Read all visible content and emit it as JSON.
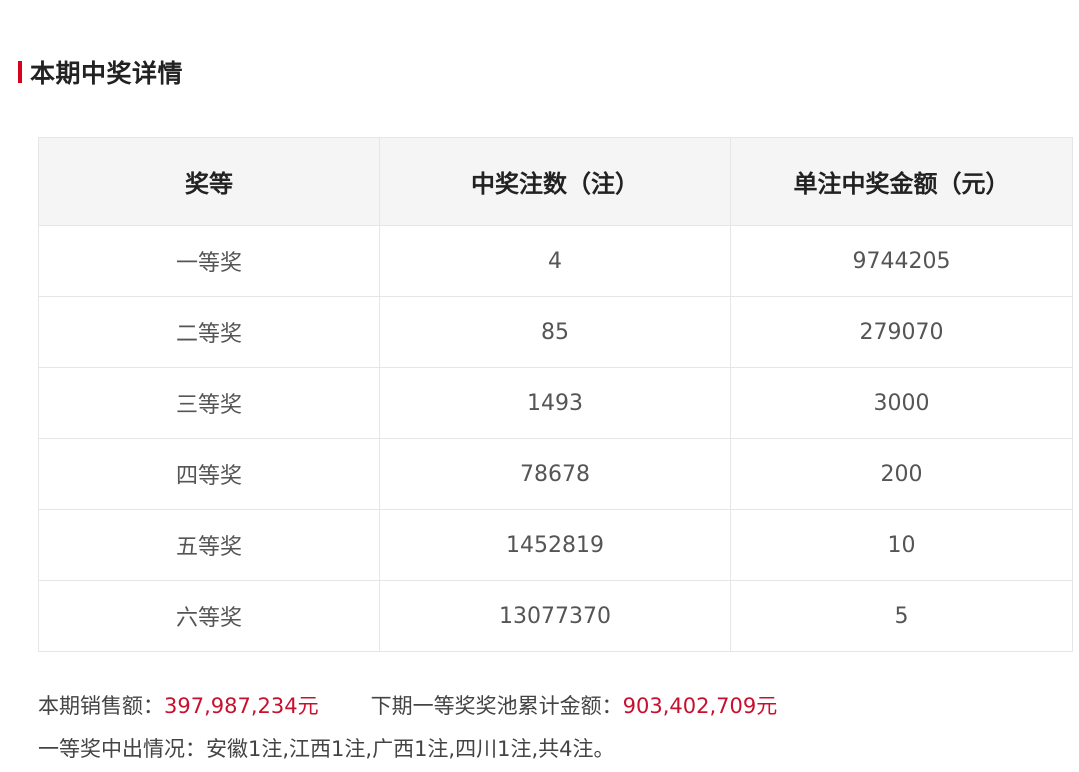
{
  "section": {
    "title": "本期中奖详情",
    "accent_color": "#d9001b"
  },
  "table": {
    "headers": [
      "奖等",
      "中奖注数（注）",
      "单注中奖金额（元）"
    ],
    "rows": [
      {
        "level": "一等奖",
        "count": "4",
        "amount": "9744205"
      },
      {
        "level": "二等奖",
        "count": "85",
        "amount": "279070"
      },
      {
        "level": "三等奖",
        "count": "1493",
        "amount": "3000"
      },
      {
        "level": "四等奖",
        "count": "78678",
        "amount": "200"
      },
      {
        "level": "五等奖",
        "count": "1452819",
        "amount": "10"
      },
      {
        "level": "六等奖",
        "count": "13077370",
        "amount": "5"
      }
    ]
  },
  "summary": {
    "sales_label": "本期销售额：",
    "sales_value": "397,987,234元",
    "pool_label": "下期一等奖奖池累计金额：",
    "pool_value": "903,402,709元",
    "winners_text": "一等奖中出情况：安徽1注,江西1注,广西1注,四川1注,共4注。",
    "highlight_color": "#c8102e"
  }
}
